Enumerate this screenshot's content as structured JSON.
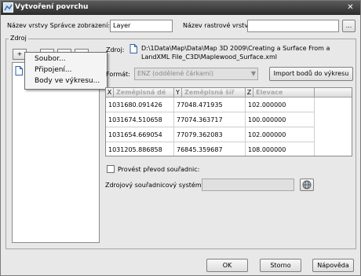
{
  "window": {
    "title": "Vytvoření povrchu"
  },
  "top": {
    "layer_name_label": "Název vrstvy Správce zobrazení:",
    "layer_name_value": "Layer",
    "raster_layer_label": "Název rastrové vrstvy:",
    "raster_layer_value": "",
    "browse_label": "..."
  },
  "source_group": {
    "legend": "Zdroj"
  },
  "toolbar": {
    "add_label": "+",
    "b2_label": "",
    "b3_label": "",
    "b4_label": ""
  },
  "context_menu": {
    "items": [
      {
        "label": "Soubor..."
      },
      {
        "label": "Připojení..."
      },
      {
        "label": "Body ve výkresu..."
      }
    ]
  },
  "tree": {
    "item_label": ""
  },
  "source": {
    "label": "Zdroj:",
    "path_line1": "D:\\1Data\\Map\\Data\\Map 3D 2009\\Creating a Surface From a",
    "path_line2": "LandXML File_C3D\\Maplewood_Surface.xml"
  },
  "format": {
    "label": "Formát:",
    "value": "ENZ (oddělené čárkami)",
    "import_button": "Import bodů do výkresu"
  },
  "table": {
    "headers": [
      {
        "key": "X",
        "name": "Zeměpisná dé"
      },
      {
        "key": "Y",
        "name": "Zeměpisná šíř"
      },
      {
        "key": "Z",
        "name": "Elevace"
      }
    ],
    "rows": [
      [
        "1031680.091426",
        "77048.471935",
        "102.000000"
      ],
      [
        "1031674.510658",
        "77074.363717",
        "100.000000"
      ],
      [
        "1031654.669054",
        "77079.362083",
        "102.000000"
      ],
      [
        "1031205.886858",
        "76845.359687",
        "108.000000"
      ]
    ]
  },
  "transform": {
    "checkbox_label": "Provést převod souřadnic:",
    "coord_system_label": "Zdrojový souřadnicový systém:",
    "coord_system_value": ""
  },
  "buttons": {
    "ok": "OK",
    "cancel": "Storno",
    "help": "Nápověda"
  },
  "colors": {
    "titlebar": "#3a3a3a",
    "window_bg": "#e8e8e8",
    "disabled_text": "#8a8a8a"
  }
}
